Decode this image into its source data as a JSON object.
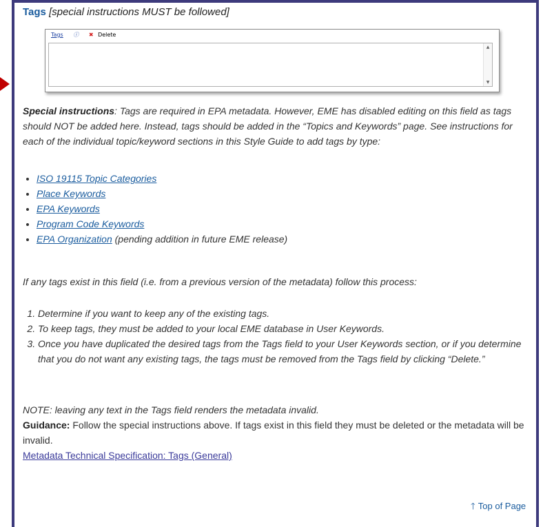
{
  "heading": {
    "title": "Tags",
    "note": "[special instructions MUST be followed]"
  },
  "form": {
    "tab_label": "Tags",
    "info_icon": "info-icon",
    "delete_icon": "x-icon",
    "delete_label": "Delete",
    "accent": "#d42020"
  },
  "special": {
    "label": "Special instructions",
    "text": ": Tags are required in EPA metadata. However, EME has disabled editing on this field as tags should NOT be added here. Instead, tags should be added in the “Topics and Keywords” page. See instructions for each of the individual topic/keyword sections in this Style Guide to add tags by type:"
  },
  "links": [
    {
      "label": "ISO 19115 Topic Categories"
    },
    {
      "label": "Place Keywords"
    },
    {
      "label": "EPA Keywords"
    },
    {
      "label": "Program Code Keywords"
    },
    {
      "label": "EPA Organization",
      "note": " (pending addition in future EME release)"
    }
  ],
  "process_intro": "If any tags exist in this field (i.e. from a previous version of the metadata) follow this process:",
  "steps": [
    "Determine if you want to keep any of the existing tags.",
    "To keep tags, they must be added to your local EME database in User Keywords.",
    "Once you have duplicated the desired tags from the Tags field to your User Keywords section, or if you determine that you do not want any existing tags, the tags must be removed from the Tags field by clicking “Delete.”"
  ],
  "note": "NOTE: leaving any text in the Tags field renders the metadata invalid.",
  "guidance": {
    "label": "Guidance:",
    "text": " Follow the special instructions above. If tags exist in this field they must be deleted or the metadata will be invalid."
  },
  "spec_link": "Metadata Technical Specification: Tags (General)",
  "top_link": "Top of Page",
  "colors": {
    "frame": "#3d3a7c",
    "link": "#1a5c9e",
    "pointer": "#c00000"
  }
}
